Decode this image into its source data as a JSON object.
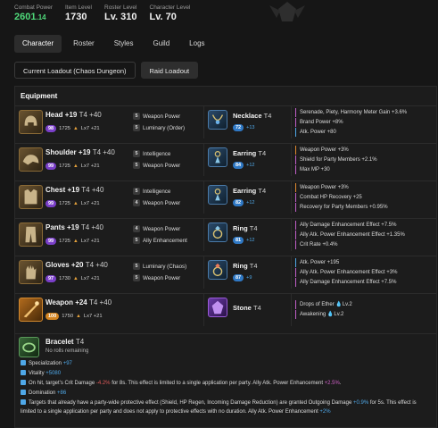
{
  "header": {
    "stats": [
      {
        "label": "Combat Power",
        "value": "2601",
        "decimal": ".14"
      },
      {
        "label": "Item Level",
        "value": "1730"
      },
      {
        "label": "Roster Level",
        "value": "Lv. 310"
      },
      {
        "label": "Character Level",
        "value": "Lv. 70"
      }
    ]
  },
  "tabs": [
    "Character",
    "Roster",
    "Styles",
    "Guild",
    "Logs"
  ],
  "loadouts": [
    "Current Loadout (Chaos Dungeon)",
    "Raid Loadout"
  ],
  "equipment": {
    "title": "Equipment",
    "items": [
      {
        "name": "Head +19",
        "tier": "T4 +40",
        "quality": "98",
        "ilvl": "1725",
        "lx": "Lx7 +21",
        "engravings": [
          {
            "n": "5",
            "label": "Weapon Power"
          },
          {
            "n": "5",
            "label": "Luminary (Order)"
          }
        ]
      },
      {
        "name": "Shoulder +19",
        "tier": "T4 +40",
        "quality": "99",
        "ilvl": "1725",
        "lx": "Lx7 +21",
        "engravings": [
          {
            "n": "5",
            "label": "Intelligence"
          },
          {
            "n": "5",
            "label": "Weapon Power"
          }
        ]
      },
      {
        "name": "Chest +19",
        "tier": "T4 +40",
        "quality": "99",
        "ilvl": "1725",
        "lx": "Lx7 +21",
        "engravings": [
          {
            "n": "5",
            "label": "Intelligence"
          },
          {
            "n": "4",
            "label": "Weapon Power"
          }
        ]
      },
      {
        "name": "Pants +19",
        "tier": "T4 +40",
        "quality": "99",
        "ilvl": "1725",
        "lx": "Lx7 +21",
        "engravings": [
          {
            "n": "4",
            "label": "Weapon Power"
          },
          {
            "n": "5",
            "label": "Ally Enhancement"
          }
        ]
      },
      {
        "name": "Gloves +20",
        "tier": "T4 +40",
        "quality": "97",
        "ilvl": "1730",
        "lx": "Lx7 +21",
        "engravings": [
          {
            "n": "5",
            "label": "Luminary (Chaos)"
          },
          {
            "n": "5",
            "label": "Weapon Power"
          }
        ]
      },
      {
        "name": "Weapon +24",
        "tier": "T4 +40",
        "quality": "100",
        "ilvl": "1750",
        "lx": "Lx7 +21",
        "engravings": []
      }
    ],
    "accessories": [
      {
        "name": "Necklace",
        "tier": "T4",
        "quality": "72",
        "bonus": "+13",
        "effects": [
          "Serenade, Piety, Harmony Meter Gain +3.6%",
          "Brand Power +8%",
          "Atk. Power +80"
        ]
      },
      {
        "name": "Earring",
        "tier": "T4",
        "quality": "84",
        "bonus": "+12",
        "effects": [
          "Weapon Power +3%",
          "Shield for Party Members +2.1%",
          "Max MP +30"
        ]
      },
      {
        "name": "Earring",
        "tier": "T4",
        "quality": "82",
        "bonus": "+12",
        "effects": [
          "Weapon Power +3%",
          "Combat HP Recovery +25",
          "Recovery for Party Members +0.95%"
        ]
      },
      {
        "name": "Ring",
        "tier": "T4",
        "quality": "81",
        "bonus": "+12",
        "effects": [
          "Ally Damage Enhancement Effect +7.5%",
          "Ally Atk. Power Enhancement Effect +1.35%",
          "Crit Rate +0.4%"
        ]
      },
      {
        "name": "Ring",
        "tier": "T4",
        "quality": "87",
        "bonus": "+9",
        "effects": [
          "Atk. Power +195",
          "Ally Atk. Power Enhancement Effect +3%",
          "Ally Damage Enhancement Effect +7.5%"
        ]
      },
      {
        "name": "Stone",
        "tier": "T4",
        "effects": [
          "Drops of Ether",
          "Awakening"
        ],
        "levels": [
          "Lv.2",
          "Lv.2"
        ]
      }
    ],
    "bracelet": {
      "name": "Bracelet",
      "tier": "T4",
      "subtitle": "No rolls remaining",
      "lines": [
        {
          "label": "Specialization",
          "value": "+97"
        },
        {
          "label": "Vitality",
          "value": "+5080"
        },
        {
          "pre": "On hit, target's Crit Damage ",
          "v1": "-4.2%",
          "mid": " for 8s. This effect is limited to a single application per party. Ally Atk. Power Enhancement ",
          "v2": "+2.5%",
          "post": "."
        },
        {
          "label": "Domination",
          "value": "+86"
        },
        {
          "pre": "Targets that already have a party-wide protective effect (Shield, HP Regen, Incoming Damage Reduction) are granted Outgoing Damage",
          "v1": "+0.9%",
          "mid": " for 5s. This effect is limited to a single application per party and does not apply to protective effects with no duration. Ally Atk. Power Enhancement ",
          "v2": "+2%",
          "post": ""
        }
      ]
    }
  }
}
